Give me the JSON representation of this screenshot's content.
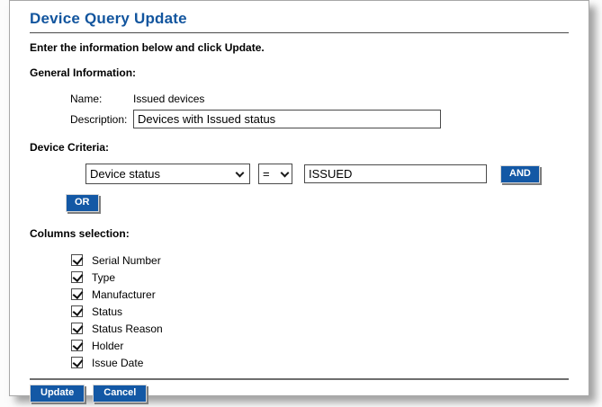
{
  "page": {
    "title": "Device Query Update",
    "instruction": "Enter the information below and click Update."
  },
  "general_info": {
    "heading": "General Information:",
    "name_label": "Name:",
    "name_value": "Issued devices",
    "description_label": "Description:",
    "description_value": "Devices with Issued status"
  },
  "device_criteria": {
    "heading": "Device Criteria:",
    "field_selected": "Device status",
    "operator_selected": "=",
    "value": "ISSUED",
    "and_button": "AND",
    "or_button": "OR"
  },
  "columns_selection": {
    "heading": "Columns selection:",
    "items": [
      {
        "label": "Serial Number",
        "checked": true
      },
      {
        "label": "Type",
        "checked": true
      },
      {
        "label": "Manufacturer",
        "checked": true
      },
      {
        "label": "Status",
        "checked": true
      },
      {
        "label": "Status Reason",
        "checked": true
      },
      {
        "label": "Holder",
        "checked": true
      },
      {
        "label": "Issue Date",
        "checked": true
      }
    ]
  },
  "actions": {
    "update_label": "Update",
    "cancel_label": "Cancel"
  },
  "colors": {
    "title_blue": "#12559E",
    "button_blue": "#1358A5"
  }
}
